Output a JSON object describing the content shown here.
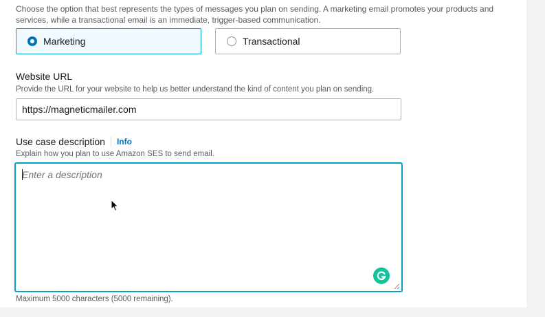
{
  "type_section": {
    "description": "Choose the option that best represents the types of messages you plan on sending. A marketing email promotes your products and services, while a transactional email is an immediate, trigger-based communication.",
    "options": [
      {
        "label": "Marketing",
        "selected": true
      },
      {
        "label": "Transactional",
        "selected": false
      }
    ]
  },
  "website_url": {
    "label": "Website URL",
    "hint": "Provide the URL for your website to help us better understand the kind of content you plan on sending.",
    "value": "https://magneticmailer.com"
  },
  "use_case": {
    "label": "Use case description",
    "info_link": "Info",
    "hint": "Explain how you plan to use Amazon SES to send email.",
    "placeholder": "Enter a description",
    "constraint": "Maximum 5000 characters  (5000 remaining)."
  },
  "icons": {
    "grammarly": "grammarly-icon",
    "cursor": "mouse-pointer-icon",
    "resize": "resize-handle-icon"
  },
  "colors": {
    "accent_blue": "#0073bb",
    "focus_cyan": "#00a1c9",
    "selected_bg": "#f1faff",
    "grammarly_green": "#15c39a"
  }
}
